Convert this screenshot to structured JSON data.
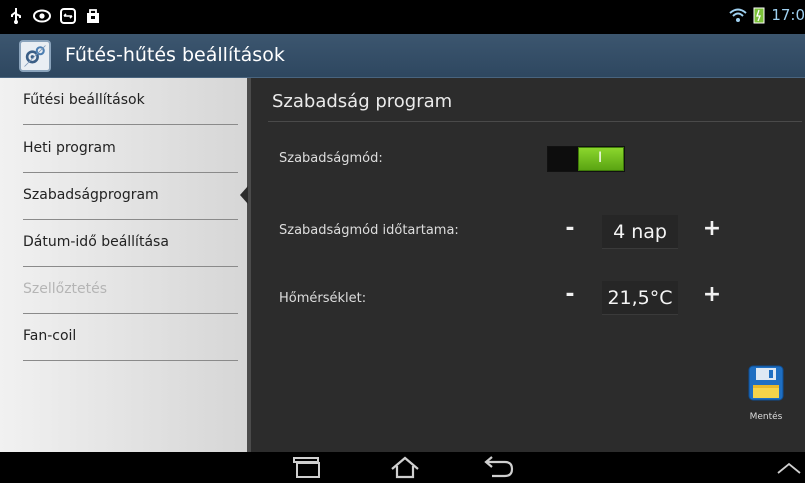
{
  "status_bar": {
    "time": "17:0",
    "left_icons": [
      "usb-icon",
      "eye-icon",
      "transfer-icon",
      "bag-icon"
    ],
    "right_icons": [
      "wifi-icon",
      "battery-icon"
    ]
  },
  "app": {
    "title": "Fűtés-hűtés beállítások",
    "icon": "settings-app-icon"
  },
  "sidebar": {
    "items": [
      {
        "label": "Fűtési beállítások",
        "enabled": true
      },
      {
        "label": "Heti program",
        "enabled": true
      },
      {
        "label": "Szabadságprogram",
        "enabled": true,
        "selected": true
      },
      {
        "label": "Dátum-idő beállítása",
        "enabled": true
      },
      {
        "label": "Szellőztetés",
        "enabled": false
      },
      {
        "label": "Fan-coil",
        "enabled": true
      }
    ]
  },
  "content": {
    "title": "Szabadság program",
    "vacation_mode": {
      "label": "Szabadságmód:",
      "toggle_text": "I",
      "on": true
    },
    "duration": {
      "label": "Szabadságmód időtartama:",
      "minus": "-",
      "value": "4 nap",
      "plus": "+"
    },
    "temperature": {
      "label": "Hőmérséklet:",
      "minus": "-",
      "value": "21,5°C",
      "plus": "+"
    },
    "save": {
      "label": "Mentés",
      "icon": "floppy-disk-icon"
    }
  },
  "nav_bar": {
    "buttons": [
      "recent-apps-icon",
      "home-icon",
      "back-icon",
      "expand-up-icon"
    ]
  },
  "colors": {
    "action_bar": "#34506a",
    "toggle_on": "#6cbd1b",
    "content_bg": "#2c2c2c",
    "sidebar_bg": "#e4e4e4"
  }
}
